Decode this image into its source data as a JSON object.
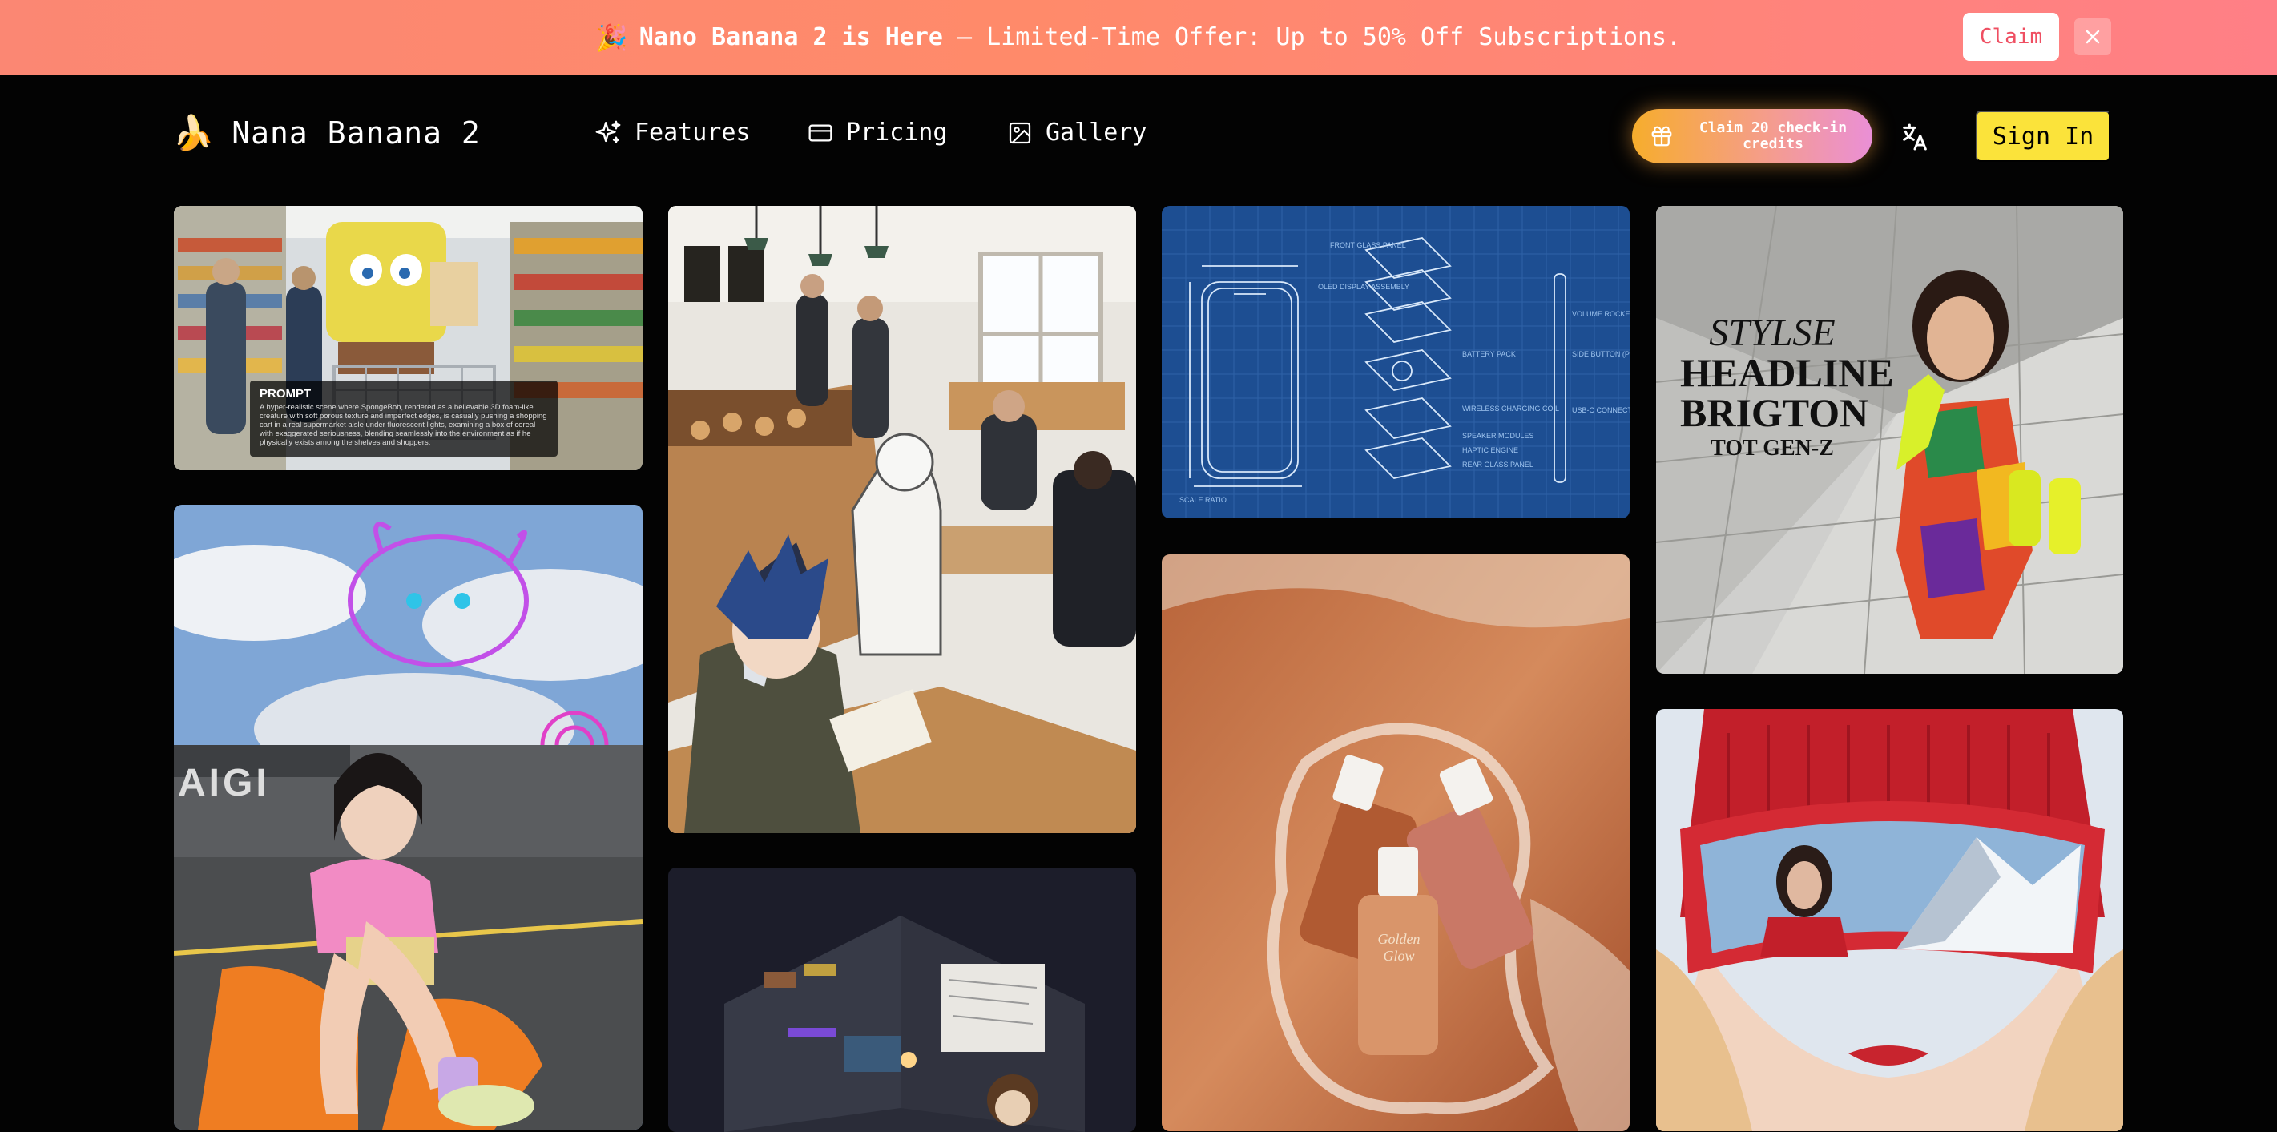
{
  "banner": {
    "icon": "party-popper-icon",
    "highlight": "Nano Banana 2 is Here",
    "rest": " — Limited-Time Offer: Up to 50% Off Subscriptions.",
    "claim_label": "Claim",
    "background": "#fb8773"
  },
  "header": {
    "logo_icon": "banana-icon",
    "logo_text": "Nana Banana 2",
    "nav": [
      {
        "label": "Features",
        "icon": "sparkles-icon"
      },
      {
        "label": "Pricing",
        "icon": "credit-card-icon"
      },
      {
        "label": "Gallery",
        "icon": "image-icon"
      }
    ],
    "credits_label": "Claim 20 check-in credits",
    "sign_in_label": "Sign In",
    "accent": "#fbe33a"
  },
  "gallery": {
    "spongebob": {
      "prompt_title": "PROMPT",
      "prompt_body": "A hyper-realistic scene where SpongeBob, rendered as a believable 3D foam-like creature with soft porous texture and imperfect edges, is casually pushing a shopping cart in a real supermarket aisle under fluorescent lights, examining a box of cereal with exaggerated seriousness, blending seamlessly into the environment as if he physically exists among the shelves and shoppers."
    },
    "fashion": {
      "line1": "STYLSE",
      "line2": "HEADLINE",
      "line3": "BRIGTON",
      "line4": "TOT GEN-Z"
    },
    "street": {
      "sign": "AIGI"
    },
    "serum": {
      "brand": "Golden Glow"
    },
    "blueprint": {
      "labels": [
        "FRONT GLASS PANEL",
        "OLED DISPLAY ASSEMBLY",
        "BATTERY PACK",
        "WIRELESS CHARGING COIL",
        "SPEAKER MODULES",
        "HAPTIC ENGINE",
        "REAR GLASS PANEL",
        "VOLUME ROCKER",
        "SIDE BUTTON (POWER)",
        "USB-C CONNECTOR PORT",
        "SCALE RATIO"
      ]
    }
  }
}
